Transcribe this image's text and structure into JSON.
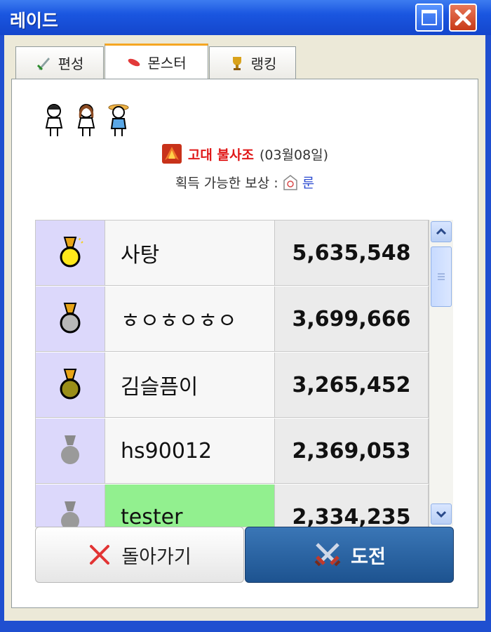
{
  "window": {
    "title": "레이드"
  },
  "tabs": [
    {
      "label": "편성",
      "icon": "sword-icon"
    },
    {
      "label": "몬스터",
      "icon": "monster-icon",
      "active": true
    },
    {
      "label": "랭킹",
      "icon": "trophy-icon"
    }
  ],
  "monster": {
    "name": "고대 불사조",
    "date": "(03월08일)"
  },
  "reward": {
    "label": "획득 가능한 보상 :",
    "item": "룬"
  },
  "ranking": [
    {
      "medal": "gold",
      "name": "사탕",
      "score": "5,635,548"
    },
    {
      "medal": "silver",
      "name": "ㅎㅇㅎㅇㅎㅇ",
      "score": "3,699,666"
    },
    {
      "medal": "bronze",
      "name": "김슬픔이",
      "score": "3,265,452"
    },
    {
      "medal": "gray",
      "name": "hs90012",
      "score": "2,369,053"
    },
    {
      "medal": "gray",
      "name": "tester",
      "score": "2,334,235",
      "highlight": true
    }
  ],
  "buttons": {
    "back": "돌아가기",
    "challenge": "도전"
  },
  "colors": {
    "titlebar": "#1f4fd0",
    "highlight_row": "#92f08f",
    "rank_column": "#dcd8fb",
    "monster_name": "#e01818"
  }
}
